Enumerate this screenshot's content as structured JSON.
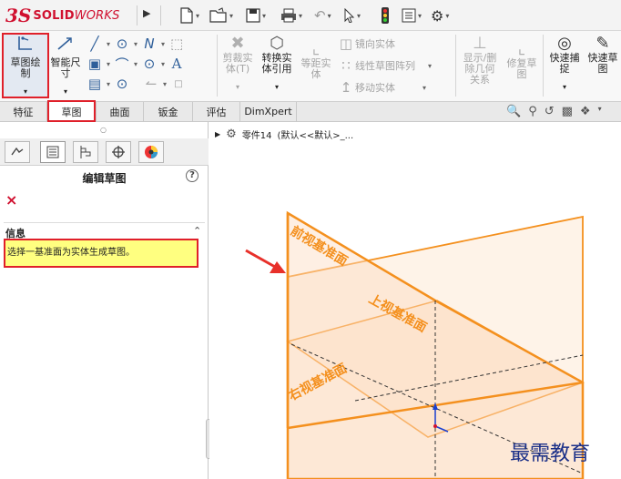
{
  "app": {
    "brand_ds": "3S",
    "brand_solid": "SOLID",
    "brand_works": "WORKS",
    "brand_color": "#d0102f"
  },
  "quick_access": {
    "items": [
      {
        "icon": "new-document-icon",
        "glyph": "□"
      },
      {
        "icon": "open-folder-icon",
        "glyph": "↗"
      },
      {
        "icon": "save-icon",
        "glyph": "▤"
      },
      {
        "icon": "print-icon",
        "glyph": "⎙"
      },
      {
        "icon": "undo-icon",
        "glyph": "↶"
      },
      {
        "icon": "select-arrow-icon",
        "glyph": "↖"
      },
      {
        "icon": "rebuild-traffic-light-icon",
        "glyph": "●"
      },
      {
        "icon": "file-properties-icon",
        "glyph": "▦"
      },
      {
        "icon": "options-gear-icon",
        "glyph": "⚙"
      }
    ]
  },
  "ribbon": {
    "sketch_button": {
      "line1": "草图绘",
      "line2": "制"
    },
    "smart_dim_button": {
      "line1": "智能尺",
      "line2": "寸"
    },
    "trim_button": {
      "line1": "剪裁实",
      "line2": "体(T)"
    },
    "convert_button": {
      "line1": "转换实",
      "line2": "体引用"
    },
    "offset_button": {
      "line1": "等距实",
      "line2": "体"
    },
    "mirror_label": "镜向实体",
    "linear_pattern_label": "线性草图阵列",
    "move_label": "移动实体",
    "show_relations_button": {
      "line1": "显示/删",
      "line2": "除几何",
      "line3": "关系"
    },
    "repair_button": {
      "line1": "修复草",
      "line2": "图"
    },
    "quick_snap_button": {
      "line1": "快速捕",
      "line2": "捉"
    },
    "rapid_sketch_button": {
      "line1": "快速草",
      "line2": "图"
    }
  },
  "tabs": [
    {
      "label": "特征",
      "active": false
    },
    {
      "label": "草图",
      "active": true
    },
    {
      "label": "曲面",
      "active": false
    },
    {
      "label": "钣金",
      "active": false
    },
    {
      "label": "评估",
      "active": false
    },
    {
      "label": "DimXpert",
      "active": false
    }
  ],
  "panel": {
    "title": "编辑草图",
    "help_glyph": "?",
    "close_glyph": "×",
    "info_header": "信息",
    "info_message": "选择一基准面为实体生成草图。",
    "info_bg": "#ffff80"
  },
  "tree": {
    "part_label": "零件14",
    "config_label": "(默认<<默认>_..."
  },
  "planes": {
    "front": "前视基准面",
    "top": "上视基准面",
    "right": "右视基准面",
    "color": "#f4901e"
  },
  "watermark": "最需教育",
  "colors": {
    "highlight_red": "#e0202a",
    "arrow_red": "#e8302a",
    "axis_blue": "#1a3fd0"
  }
}
